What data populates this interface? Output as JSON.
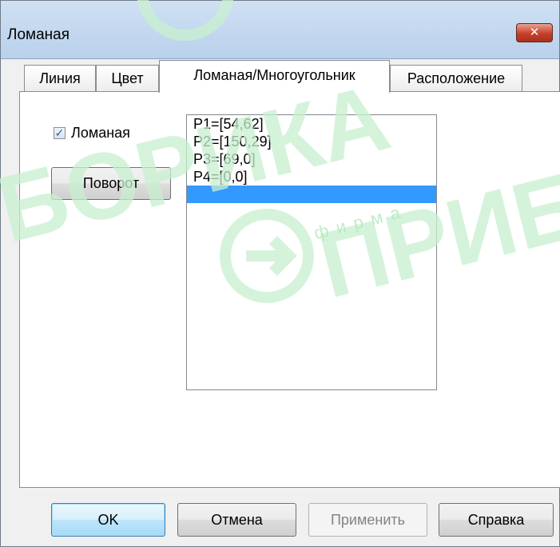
{
  "window": {
    "title": "Ломаная",
    "close_label": "✕"
  },
  "tabs": [
    {
      "label": "Линия",
      "active": false
    },
    {
      "label": "Цвет",
      "active": false
    },
    {
      "label": "Ломаная/Многоугольник",
      "active": true
    },
    {
      "label": "Расположение",
      "active": false
    }
  ],
  "panel": {
    "polyline_checkbox": {
      "label": "Ломаная",
      "checked": true
    },
    "rotate_button": "Поворот",
    "points": [
      "P1=[54,62]",
      "P2=[150,29]",
      "P3=[69,0]",
      "P4=[0,0]",
      ""
    ],
    "selected_index": 4
  },
  "buttons": {
    "ok": "OK",
    "cancel": "Отмена",
    "apply": "Применить",
    "help": "Справка"
  },
  "watermark": {
    "text_left": "БОРИКА",
    "text_right": "ПРИБ",
    "small": "фирма"
  },
  "colors": {
    "selection": "#3399ff",
    "watermark": "#c8f0cf",
    "titlebar": "#c3d8f0"
  }
}
